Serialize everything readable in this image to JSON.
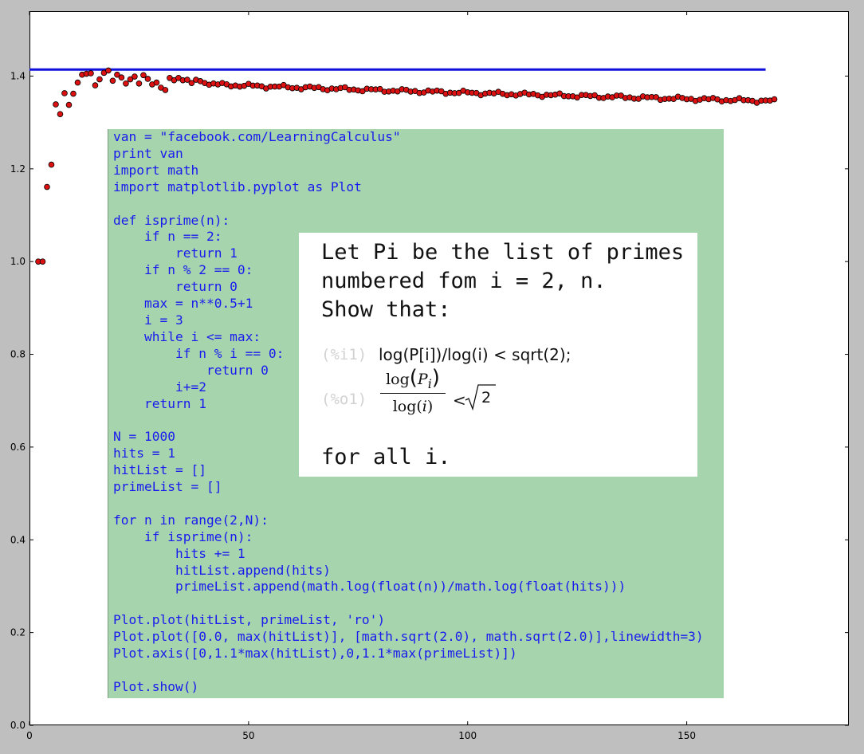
{
  "chart_data": {
    "type": "scatter",
    "title": "",
    "xlabel": "",
    "ylabel": "",
    "xlim": [
      0,
      187
    ],
    "ylim": [
      0.0,
      1.54
    ],
    "x_ticks": [
      0,
      50,
      100,
      150
    ],
    "y_ticks": [
      0.0,
      0.2,
      0.4,
      0.6,
      0.8,
      1.0,
      1.2,
      1.4
    ],
    "x_tick_labels": [
      "0",
      "50",
      "100",
      "150"
    ],
    "y_tick_labels": [
      "0.0",
      "0.2",
      "0.4",
      "0.6",
      "0.8",
      "1.0",
      "1.2",
      "1.4"
    ],
    "marker_color": "#dd1111",
    "line_color": "#1111dd",
    "series": [
      {
        "type": "points",
        "x": [
          2,
          3,
          4,
          5,
          6,
          7,
          8,
          9,
          10,
          11,
          12,
          13,
          14,
          15,
          16,
          17,
          18,
          19,
          20,
          21,
          22,
          23,
          24,
          25,
          26,
          27,
          28,
          29,
          30,
          31,
          32,
          33,
          34,
          35,
          36,
          37,
          38,
          39,
          40
        ],
        "y": [
          1.0,
          1.0,
          1.161,
          1.209,
          1.339,
          1.318,
          1.363,
          1.338,
          1.362,
          1.386,
          1.403,
          1.405,
          1.406,
          1.38,
          1.393,
          1.407,
          1.412,
          1.39,
          1.403,
          1.397,
          1.384,
          1.393,
          1.399,
          1.384,
          1.402,
          1.394,
          1.382,
          1.386,
          1.375,
          1.37,
          1.396,
          1.391,
          1.396,
          1.391,
          1.392,
          1.385,
          1.392,
          1.389,
          1.385
        ]
      },
      {
        "type": "line",
        "x": [
          0.0,
          168
        ],
        "y": [
          1.4142,
          1.4142
        ]
      }
    ],
    "trend_tail": {
      "x_start": 41,
      "x_end": 170,
      "y_start": 1.383,
      "y_end": 1.346
    }
  },
  "code_lines": [
    "van = \"facebook.com/LearningCalculus\"",
    "print van",
    "import math",
    "import matplotlib.pyplot as Plot",
    "",
    "def isprime(n):",
    "    if n == 2:",
    "        return 1",
    "    if n % 2 == 0:",
    "        return 0",
    "    max = n**0.5+1",
    "    i = 3",
    "    while i <= max:",
    "        if n % i == 0:",
    "            return 0",
    "        i+=2",
    "    return 1",
    "",
    "N = 1000",
    "hits = 1",
    "hitList = []",
    "primeList = []",
    "",
    "for n in range(2,N):",
    "    if isprime(n):",
    "        hits += 1",
    "        hitList.append(hits)",
    "        primeList.append(math.log(float(n))/math.log(float(hits)))",
    "",
    "Plot.plot(hitList, primeList, 'ro')",
    "Plot.plot([0.0, max(hitList)], [math.sqrt(2.0), math.sqrt(2.0)],linewidth=3)",
    "Plot.axis([0,1.1*max(hitList),0,1.1*max(primeList)])",
    "",
    "Plot.show()"
  ],
  "note": {
    "line1": "Let Pi be the list of primes",
    "line2": "numbered fom i = 2, n.",
    "line3": "Show that:",
    "input_tag": "(%i1)",
    "input_expr": "log(P[i])/log(i) < sqrt(2);",
    "output_tag": "(%o1)",
    "output_num_fn": "log",
    "output_num_var": "P",
    "output_num_sub": "i",
    "output_den_fn": "log",
    "output_den_var": "i",
    "output_rel": "<",
    "output_rhs": "2",
    "closing": "for all i."
  }
}
